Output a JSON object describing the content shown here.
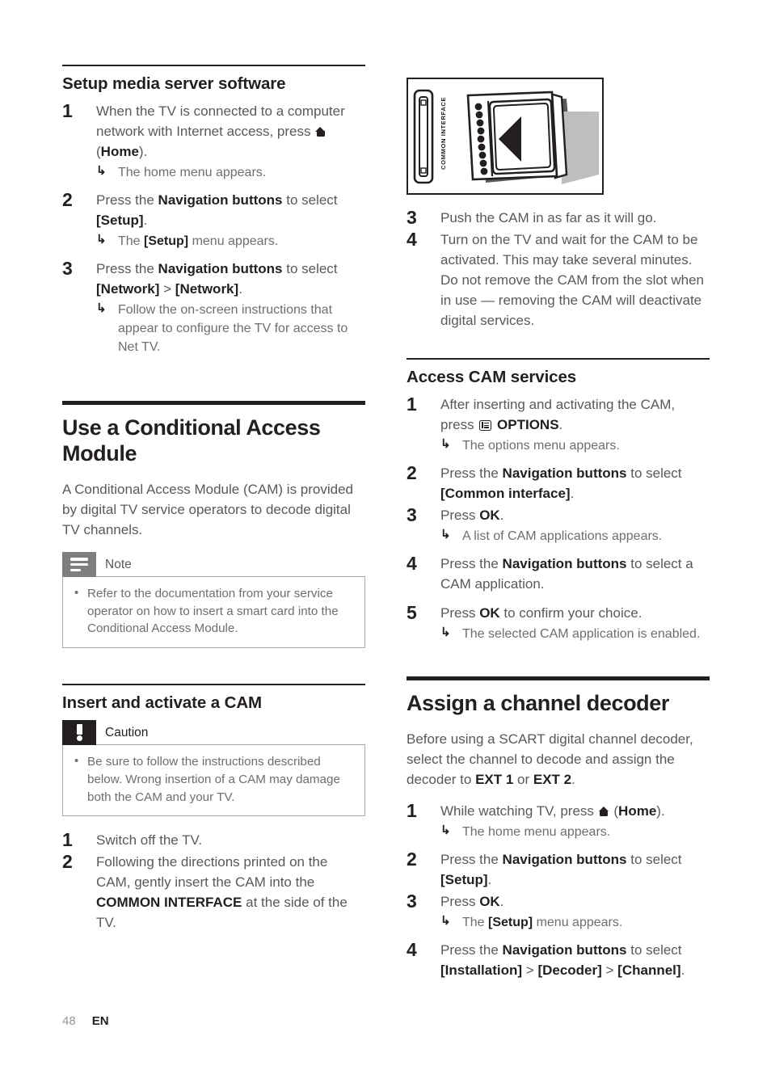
{
  "page": {
    "number": "48",
    "language": "EN"
  },
  "left_column": {
    "section1": {
      "heading": "Setup media server software",
      "steps": [
        {
          "num": "1",
          "text_1": "When the TV is connected to a computer network with Internet access, press ",
          "icon": "home-icon",
          "text_2": " (",
          "bold": "Home",
          "text_3": ").",
          "result": "The home menu appears."
        },
        {
          "num": "2",
          "text_1": "Press the ",
          "bold_1": "Navigation buttons",
          "text_2": " to select ",
          "bold_2": "[Setup]",
          "text_3": ".",
          "result_1": "The ",
          "result_bold": "[Setup]",
          "result_2": " menu appears."
        },
        {
          "num": "3",
          "text_1": "Press the ",
          "bold_1": "Navigation buttons",
          "text_2": " to select ",
          "bold_2": "[Network]",
          "text_3": " > ",
          "bold_3": "[Network]",
          "text_4": ".",
          "result": "Follow the on-screen instructions that appear to configure the TV for access to Net TV."
        }
      ]
    },
    "section2": {
      "heading": "Use a Conditional Access Module",
      "intro": "A Conditional Access Module (CAM) is provided by digital TV service operators to decode digital TV channels.",
      "note": {
        "title": "Note",
        "icon": "note-lines-icon",
        "items": [
          "Refer to the documentation from your service operator on how to insert a smart card into the Conditional Access Module."
        ]
      },
      "subsection": {
        "heading": "Insert and activate a CAM",
        "caution": {
          "title": "Caution",
          "icon": "exclamation-icon",
          "items": [
            "Be sure to follow the instructions described below. Wrong insertion of a CAM may damage both the CAM and your TV."
          ]
        },
        "steps": [
          {
            "num": "1",
            "text_1": "Switch off the TV."
          },
          {
            "num": "2",
            "text_1": "Following the directions printed on the CAM, gently insert the CAM into the ",
            "bold_1": "COMMON INTERFACE",
            "text_2": " at the side of the TV."
          }
        ]
      }
    }
  },
  "right_column": {
    "figure": {
      "name": "cam-insertion-illustration",
      "slot_label": "COMMON INTERFACE",
      "colors": {
        "outline": "#231f20",
        "arrow_gray": "#bcbec0",
        "shadow_gray": "#58595b"
      }
    },
    "cam_steps_continued": [
      {
        "num": "3",
        "text_1": "Push the CAM in as far as it will go."
      },
      {
        "num": "4",
        "text_1": "Turn on the TV and wait for the CAM to be activated. This may take several minutes. Do not remove the CAM from the slot when in use — removing the CAM will deactivate digital services."
      }
    ],
    "section_access": {
      "heading": "Access CAM services",
      "steps": [
        {
          "num": "1",
          "text_1": "After inserting and activating the CAM, press ",
          "icon": "options-icon",
          "bold_1": " OPTIONS",
          "text_2": ".",
          "result": "The options menu appears."
        },
        {
          "num": "2",
          "text_1": "Press the ",
          "bold_1": "Navigation buttons",
          "text_2": " to select ",
          "bold_2": "[Common interface]",
          "text_3": "."
        },
        {
          "num": "3",
          "text_1": "Press ",
          "bold_1": "OK",
          "text_2": ".",
          "result": "A list of CAM applications appears."
        },
        {
          "num": "4",
          "text_1": "Press the ",
          "bold_1": "Navigation buttons",
          "text_2": " to select a CAM application."
        },
        {
          "num": "5",
          "text_1": "Press ",
          "bold_1": "OK",
          "text_2": " to confirm your choice.",
          "result": "The selected CAM application is enabled."
        }
      ]
    },
    "section_decoder": {
      "heading": "Assign a channel decoder",
      "intro_1": "Before using a SCART digital channel decoder, select the channel to decode and assign the decoder to ",
      "intro_bold_1": "EXT 1",
      "intro_2": " or ",
      "intro_bold_2": "EXT 2",
      "intro_3": ".",
      "steps": [
        {
          "num": "1",
          "text_1": "While watching TV, press ",
          "icon": "home-icon",
          "text_2": " (",
          "bold_1": "Home",
          "text_3": ").",
          "result": "The home menu appears."
        },
        {
          "num": "2",
          "text_1": "Press the ",
          "bold_1": "Navigation buttons",
          "text_2": " to select ",
          "bold_2": "[Setup]",
          "text_3": "."
        },
        {
          "num": "3",
          "text_1": "Press ",
          "bold_1": "OK",
          "text_2": ".",
          "result_1": "The ",
          "result_bold": "[Setup]",
          "result_2": " menu appears."
        },
        {
          "num": "4",
          "text_1": "Press the ",
          "bold_1": "Navigation buttons",
          "text_2": " to select ",
          "bold_2": "[Installation]",
          "text_3": " > ",
          "bold_3": "[Decoder]",
          "text_4": " > ",
          "bold_4": "[Channel]",
          "text_5": "."
        }
      ]
    }
  }
}
